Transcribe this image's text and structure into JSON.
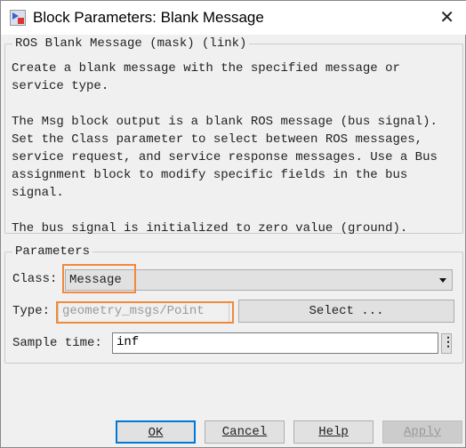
{
  "window": {
    "title": "Block Parameters: Blank Message",
    "close_icon": "close-icon"
  },
  "description": {
    "legend": "ROS Blank Message (mask) (link)",
    "text": "Create a blank message with the specified message or\nservice type.\n\nThe Msg block output is a blank ROS message (bus signal).\nSet the Class parameter to select between ROS messages,\nservice request, and service response messages. Use a Bus\nassignment block to modify specific fields in the bus\nsignal.\n\nThe bus signal is initialized to zero value (ground)."
  },
  "parameters": {
    "legend": "Parameters",
    "class_label": "Class:",
    "class_value": "Message",
    "type_label": "Type:",
    "type_value": "geometry_msgs/Point",
    "select_button": "Select ...",
    "sample_label": "Sample time:",
    "sample_value": "inf"
  },
  "buttons": {
    "ok": "OK",
    "cancel": "Cancel",
    "help": "Help",
    "apply": "Apply"
  },
  "colors": {
    "highlight": "#f08a3c",
    "focus": "#0078d7"
  }
}
